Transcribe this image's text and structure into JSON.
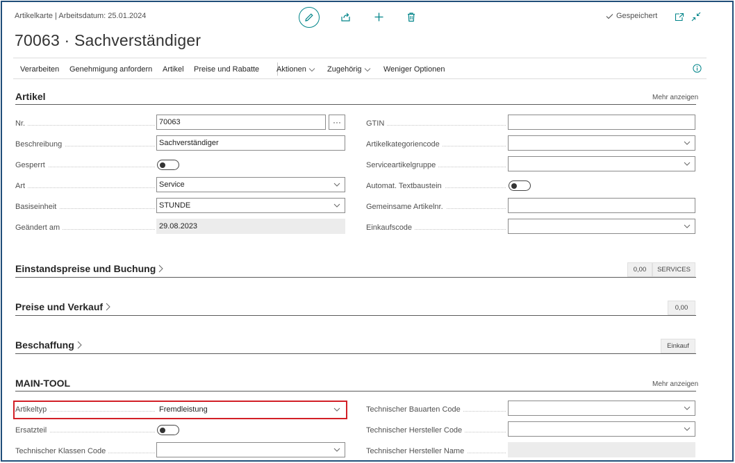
{
  "header": {
    "breadcrumb": "Artikelkarte | Arbeitsdatum: 25.01.2024",
    "title": "70063 · Sachverständiger",
    "saved_label": "Gespeichert"
  },
  "actions": {
    "items": [
      "Verarbeiten",
      "Genehmigung anfordern",
      "Artikel",
      "Preise und Rabatte"
    ],
    "dropdowns": [
      "Aktionen",
      "Zugehörig"
    ],
    "less_options": "Weniger Optionen"
  },
  "artikel": {
    "title": "Artikel",
    "more": "Mehr anzeigen",
    "left": [
      {
        "label": "Nr.",
        "value": "70063"
      },
      {
        "label": "Beschreibung",
        "value": "Sachverständiger"
      },
      {
        "label": "Gesperrt",
        "value": ""
      },
      {
        "label": "Art",
        "value": "Service"
      },
      {
        "label": "Basiseinheit",
        "value": "STUNDE"
      },
      {
        "label": "Geändert am",
        "value": "29.08.2023"
      }
    ],
    "right": [
      {
        "label": "GTIN",
        "value": ""
      },
      {
        "label": "Artikelkategoriencode",
        "value": ""
      },
      {
        "label": "Serviceartikelgruppe",
        "value": ""
      },
      {
        "label": "Automat. Textbaustein",
        "value": ""
      },
      {
        "label": "Gemeinsame Artikelnr.",
        "value": ""
      },
      {
        "label": "Einkaufscode",
        "value": ""
      }
    ],
    "lookup_button": "···"
  },
  "einstand": {
    "title": "Einstandspreise und Buchung",
    "badge1": "0,00",
    "badge2": "SERVICES"
  },
  "preise": {
    "title": "Preise und Verkauf",
    "badge1": "0,00"
  },
  "beschaffung": {
    "title": "Beschaffung",
    "badge1": "Einkauf"
  },
  "maintool": {
    "title": "MAIN-TOOL",
    "more": "Mehr anzeigen",
    "left": [
      {
        "label": "Artikeltyp",
        "value": "Fremdleistung"
      },
      {
        "label": "Ersatzteil",
        "value": ""
      },
      {
        "label": "Technischer Klassen Code",
        "value": ""
      }
    ],
    "right": [
      {
        "label": "Technischer Bauarten Code",
        "value": ""
      },
      {
        "label": "Technischer Hersteller Code",
        "value": ""
      },
      {
        "label": "Technischer Hersteller Name",
        "value": ""
      }
    ]
  },
  "colors": {
    "accent": "#008489",
    "highlight": "#d21f26",
    "frame": "#1f4e79"
  },
  "icons": [
    "pencil-icon",
    "share-icon",
    "plus-icon",
    "trash-icon",
    "checkmark-icon",
    "open-new-window-icon",
    "collapse-icon",
    "info-icon",
    "chevron-down-icon",
    "chevron-right-icon"
  ]
}
